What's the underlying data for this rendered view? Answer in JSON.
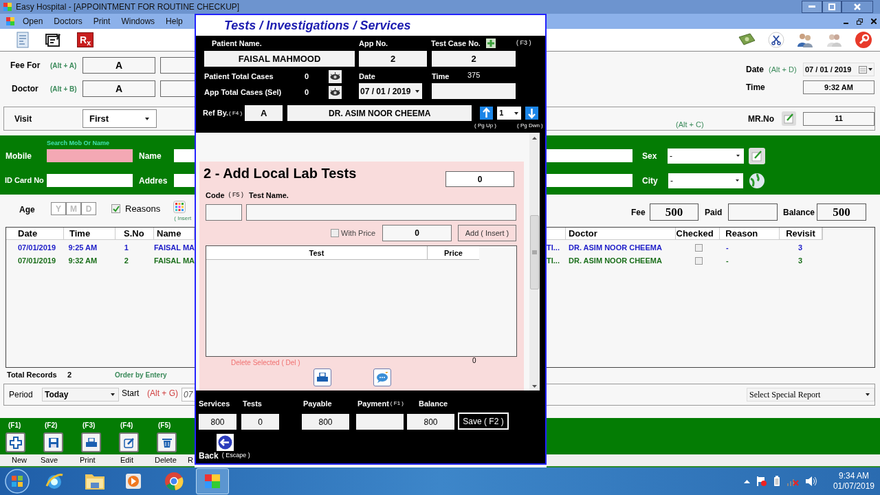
{
  "window": {
    "title": "Easy Hospital - [APPOINTMENT FOR ROUTINE CHECKUP]"
  },
  "menu": [
    "Open",
    "Doctors",
    "Print",
    "Windows",
    "Help"
  ],
  "toolbar_badge": "R$_{x}$",
  "form": {
    "fee_for": {
      "label": "Fee For",
      "shortcut": "(Alt + A)",
      "value": "A"
    },
    "doctor": {
      "label": "Doctor",
      "shortcut": "(Alt + B)",
      "value": "A"
    },
    "date": {
      "label": "Date",
      "shortcut": "(Alt + D)",
      "value": "07 / 01 / 2019"
    },
    "time": {
      "label": "Time",
      "value": "9:32 AM"
    },
    "visit": {
      "label": "Visit",
      "value": "First"
    },
    "alt_c": "(Alt + C)",
    "mr_no": {
      "label": "MR.No",
      "value": "11"
    }
  },
  "patient": {
    "search_hint": "Search Mob Or Name",
    "mobile": "Mobile",
    "name": "Name",
    "id_card": "ID Card No",
    "address": "Addres",
    "sex": {
      "label": "Sex",
      "value": "-"
    },
    "city": {
      "label": "City",
      "value": "-"
    }
  },
  "age": {
    "label": "Age",
    "units": [
      "Y",
      "M",
      "D"
    ]
  },
  "reasons": {
    "label": "Reasons",
    "checked": true
  },
  "insert_hint": "( Insert",
  "fee": {
    "fee_label": "Fee",
    "fee": "500",
    "paid_label": "Paid",
    "balance_label": "Balance",
    "balance": "500"
  },
  "appointments": {
    "left_columns": [
      "Date",
      "Time",
      "S.No",
      "Name"
    ],
    "right_columns": [
      "Doctor",
      "Checked",
      "Reason",
      "Revisit"
    ],
    "rows": [
      {
        "date": "07/01/2019",
        "time": "9:25 AM",
        "sno": "1",
        "name": "FAISAL MA",
        "column_5": "TI...",
        "doctor": "DR. ASIM NOOR CHEEMA",
        "checked": false,
        "reason": "-",
        "revisit": "3",
        "color": "#1c1cc8"
      },
      {
        "date": "07/01/2019",
        "time": "9:32 AM",
        "sno": "2",
        "name": "FAISAL MA",
        "column_5": "TI...",
        "doctor": "DR. ASIM NOOR CHEEMA",
        "checked": false,
        "reason": "-",
        "revisit": "3",
        "color": "#1a6e1a"
      }
    ]
  },
  "totals": {
    "label": "Total Records",
    "count": "2",
    "order": "Order by Entery"
  },
  "period": {
    "label": "Period",
    "value": "Today",
    "start_label": "Start",
    "shortcut": "(Alt + G)",
    "start_value": "07"
  },
  "special_report": "Select Special Report",
  "actions": [
    {
      "key": "(F1)",
      "label": "New",
      "kind": "new"
    },
    {
      "key": "(F2)",
      "label": "Save",
      "kind": "save"
    },
    {
      "key": "(F3)",
      "label": "Print",
      "kind": "print"
    },
    {
      "key": "(F4)",
      "label": "Edit",
      "kind": "edit"
    },
    {
      "key": "(F5)",
      "label": "Delete",
      "kind": "delete"
    }
  ],
  "actions_cut_label": "R",
  "modal": {
    "title": "Tests / Investigations / Services",
    "patient_name": {
      "label": "Patient Name.",
      "value": "FAISAL MAHMOOD"
    },
    "app_no": {
      "label": "App No.",
      "value": "2"
    },
    "test_case_no": {
      "label": "Test Case No.",
      "value": "2",
      "shortcut": "( F3 )"
    },
    "patient_total_cases": {
      "label": "Patient Total Cases",
      "value": "0"
    },
    "app_total_cases": {
      "label": "App Total Cases (Sel)",
      "value": "0"
    },
    "date": {
      "label": "Date",
      "value": "07 / 01 / 2019"
    },
    "time": {
      "label": "Time",
      "counter": "375"
    },
    "ref_by": {
      "label": "Ref By.",
      "shortcut": "( F4 )",
      "code": "A",
      "doctor": "DR. ASIM NOOR CHEEMA"
    },
    "page": {
      "value": "1",
      "up": "( Pg Up )",
      "down": "( Pg Dwn )"
    },
    "lab": {
      "title": "2 - Add Local Lab Tests",
      "count": "0",
      "code_label": "Code",
      "code_shortcut": "( F5 )",
      "test_name_label": "Test Name.",
      "with_price": {
        "label": "With Price",
        "checked": false
      },
      "price": "0",
      "add_button": "Add ( Insert )",
      "columns": [
        "Test",
        "Price"
      ],
      "delete_label": "Delete Selected ( Del )",
      "total": "0"
    },
    "summary": [
      {
        "label": "Services",
        "value": "800"
      },
      {
        "label": "Tests",
        "value": "0"
      },
      {
        "label": "Payable",
        "value": "800"
      },
      {
        "label": "Payment",
        "shortcut": "( F1 )"
      },
      {
        "label": "Balance",
        "value": "800"
      }
    ],
    "save_button": "Save ( F2 )",
    "back": {
      "label": "Back",
      "shortcut": "( Escape )"
    }
  },
  "taskbar": {
    "time": "9:34 AM",
    "date": "01/07/2019"
  }
}
